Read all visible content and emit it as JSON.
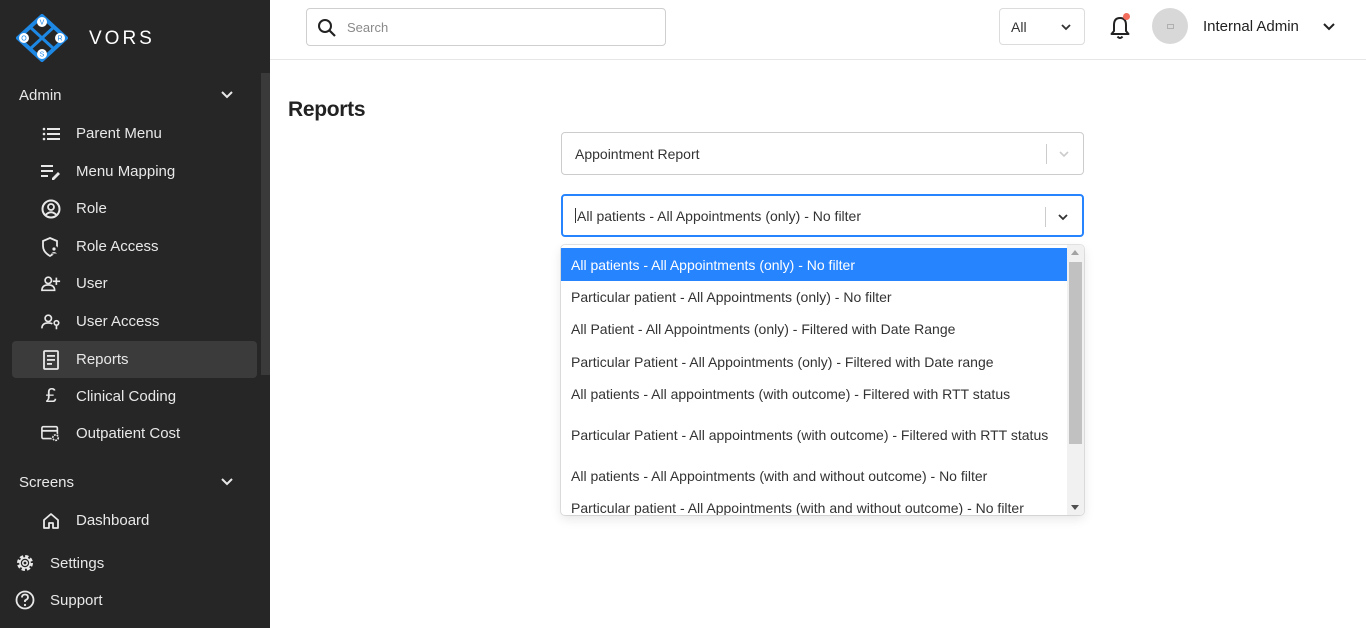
{
  "app": {
    "logo_text": "VORS",
    "logo_letters": [
      "V",
      "O",
      "R",
      "S"
    ]
  },
  "sidebar": {
    "admin_section": "Admin",
    "admin_items": [
      {
        "label": "Parent Menu",
        "icon": "list-icon"
      },
      {
        "label": "Menu Mapping",
        "icon": "edit-list-icon"
      },
      {
        "label": "Role",
        "icon": "user-circle-icon"
      },
      {
        "label": "Role Access",
        "icon": "shield-user-icon"
      },
      {
        "label": "User",
        "icon": "user-plus-icon"
      },
      {
        "label": "User Access",
        "icon": "user-key-icon"
      },
      {
        "label": "Reports",
        "icon": "report-icon",
        "active": true
      },
      {
        "label": "Clinical Coding",
        "icon": "pound-icon"
      },
      {
        "label": "Outpatient Cost",
        "icon": "card-gear-icon"
      }
    ],
    "screens_section": "Screens",
    "screens_items": [
      {
        "label": "Dashboard",
        "icon": "home-icon"
      }
    ],
    "bottom_items": [
      {
        "label": "Settings",
        "icon": "gear-icon"
      },
      {
        "label": "Support",
        "icon": "help-circle-icon"
      }
    ]
  },
  "header": {
    "search_placeholder": "Search",
    "filter_value": "All",
    "user_name": "Internal Admin"
  },
  "main": {
    "title": "Reports",
    "report_type_value": "Appointment Report",
    "report_filter_value": "All patients - All Appointments (only) - No filter",
    "options": [
      "All patients - All Appointments (only) - No filter",
      "Particular patient - All Appointments (only) - No filter",
      "All Patient - All Appointments (only) - Filtered with Date Range",
      "Particular Patient - All Appointments (only) - Filtered with Date range",
      "All patients - All appointments (with outcome) - Filtered with RTT status",
      "Particular Patient - All appointments (with outcome) - Filtered with RTT status",
      "All patients - All Appointments (with and without outcome) - No filter",
      "Particular patient - All Appointments (with and without outcome) - No filter"
    ]
  },
  "colors": {
    "sidebar_bg": "#262626",
    "active_item_bg": "#3b3b3b",
    "accent": "#2684ff",
    "notification_dot": "#f26d5b",
    "logo_blue": "#1e88e5"
  }
}
